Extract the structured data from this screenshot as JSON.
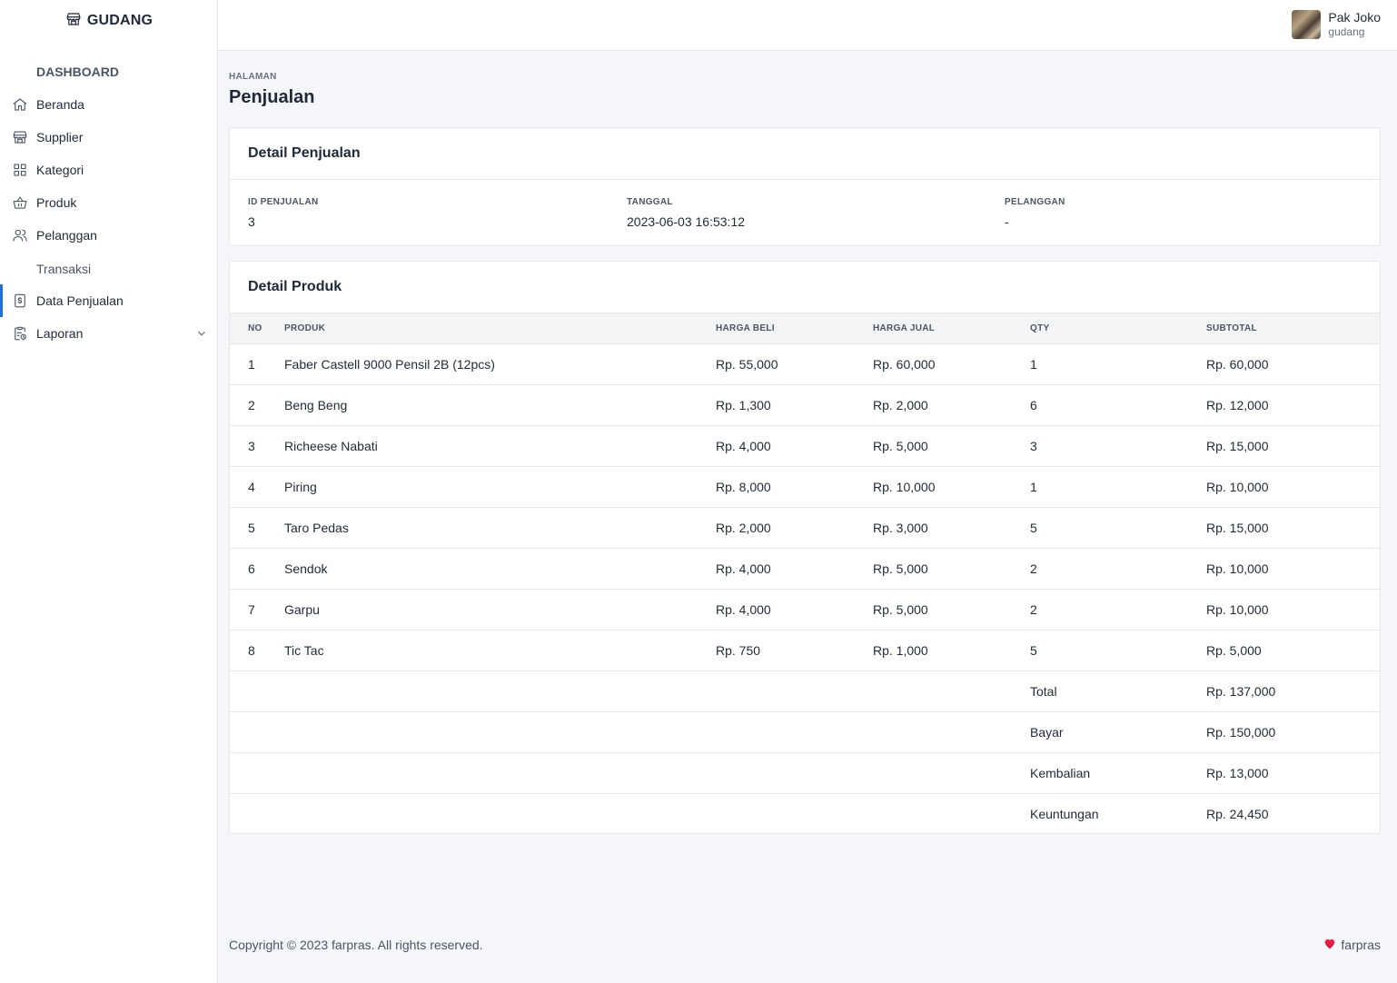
{
  "app": {
    "brand": "GUDANG"
  },
  "sidebar": {
    "sections": {
      "dashboard": "DASHBOARD",
      "transaksi": "Transaksi"
    },
    "items": [
      {
        "label": "Beranda",
        "icon": "home-icon"
      },
      {
        "label": "Supplier",
        "icon": "store-icon"
      },
      {
        "label": "Kategori",
        "icon": "grid-icon"
      },
      {
        "label": "Produk",
        "icon": "basket-icon"
      },
      {
        "label": "Pelanggan",
        "icon": "users-icon"
      },
      {
        "label": "Data Penjualan",
        "icon": "receipt-icon",
        "active": true
      },
      {
        "label": "Laporan",
        "icon": "report-icon",
        "has_submenu": true
      }
    ]
  },
  "user": {
    "name": "Pak Joko",
    "role": "gudang"
  },
  "page": {
    "subtitle": "HALAMAN",
    "title": "Penjualan"
  },
  "sale_detail": {
    "header": "Detail Penjualan",
    "fields": {
      "id": {
        "label": "ID PENJUALAN",
        "value": "3"
      },
      "date": {
        "label": "TANGGAL",
        "value": "2023-06-03 16:53:12"
      },
      "customer": {
        "label": "PELANGGAN",
        "value": "-"
      }
    }
  },
  "products": {
    "header": "Detail Produk",
    "columns": {
      "no": "NO",
      "produk": "PRODUK",
      "harga_beli": "HARGA BELI",
      "harga_jual": "HARGA JUAL",
      "qty": "QTY",
      "subtotal": "SUBTOTAL"
    },
    "rows": [
      {
        "no": "1",
        "produk": "Faber Castell 9000 Pensil 2B (12pcs)",
        "harga_beli": "Rp. 55,000",
        "harga_jual": "Rp. 60,000",
        "qty": "1",
        "subtotal": "Rp. 60,000"
      },
      {
        "no": "2",
        "produk": "Beng Beng",
        "harga_beli": "Rp. 1,300",
        "harga_jual": "Rp. 2,000",
        "qty": "6",
        "subtotal": "Rp. 12,000"
      },
      {
        "no": "3",
        "produk": "Richeese Nabati",
        "harga_beli": "Rp. 4,000",
        "harga_jual": "Rp. 5,000",
        "qty": "3",
        "subtotal": "Rp. 15,000"
      },
      {
        "no": "4",
        "produk": "Piring",
        "harga_beli": "Rp. 8,000",
        "harga_jual": "Rp. 10,000",
        "qty": "1",
        "subtotal": "Rp. 10,000"
      },
      {
        "no": "5",
        "produk": "Taro Pedas",
        "harga_beli": "Rp. 2,000",
        "harga_jual": "Rp. 3,000",
        "qty": "5",
        "subtotal": "Rp. 15,000"
      },
      {
        "no": "6",
        "produk": "Sendok",
        "harga_beli": "Rp. 4,000",
        "harga_jual": "Rp. 5,000",
        "qty": "2",
        "subtotal": "Rp. 10,000"
      },
      {
        "no": "7",
        "produk": "Garpu",
        "harga_beli": "Rp. 4,000",
        "harga_jual": "Rp. 5,000",
        "qty": "2",
        "subtotal": "Rp. 10,000"
      },
      {
        "no": "8",
        "produk": "Tic Tac",
        "harga_beli": "Rp. 750",
        "harga_jual": "Rp. 1,000",
        "qty": "5",
        "subtotal": "Rp. 5,000"
      }
    ],
    "summary": [
      {
        "label": "Total",
        "value": "Rp. 137,000"
      },
      {
        "label": "Bayar",
        "value": "Rp. 150,000"
      },
      {
        "label": "Kembalian",
        "value": "Rp. 13,000"
      },
      {
        "label": "Keuntungan",
        "value": "Rp. 24,450"
      }
    ]
  },
  "footer": {
    "copyright": "Copyright © 2023 farpras. All rights reserved.",
    "credit": "farpras",
    "heart_color": "#e11d48"
  },
  "colors": {
    "accent": "#1e6fd9"
  }
}
